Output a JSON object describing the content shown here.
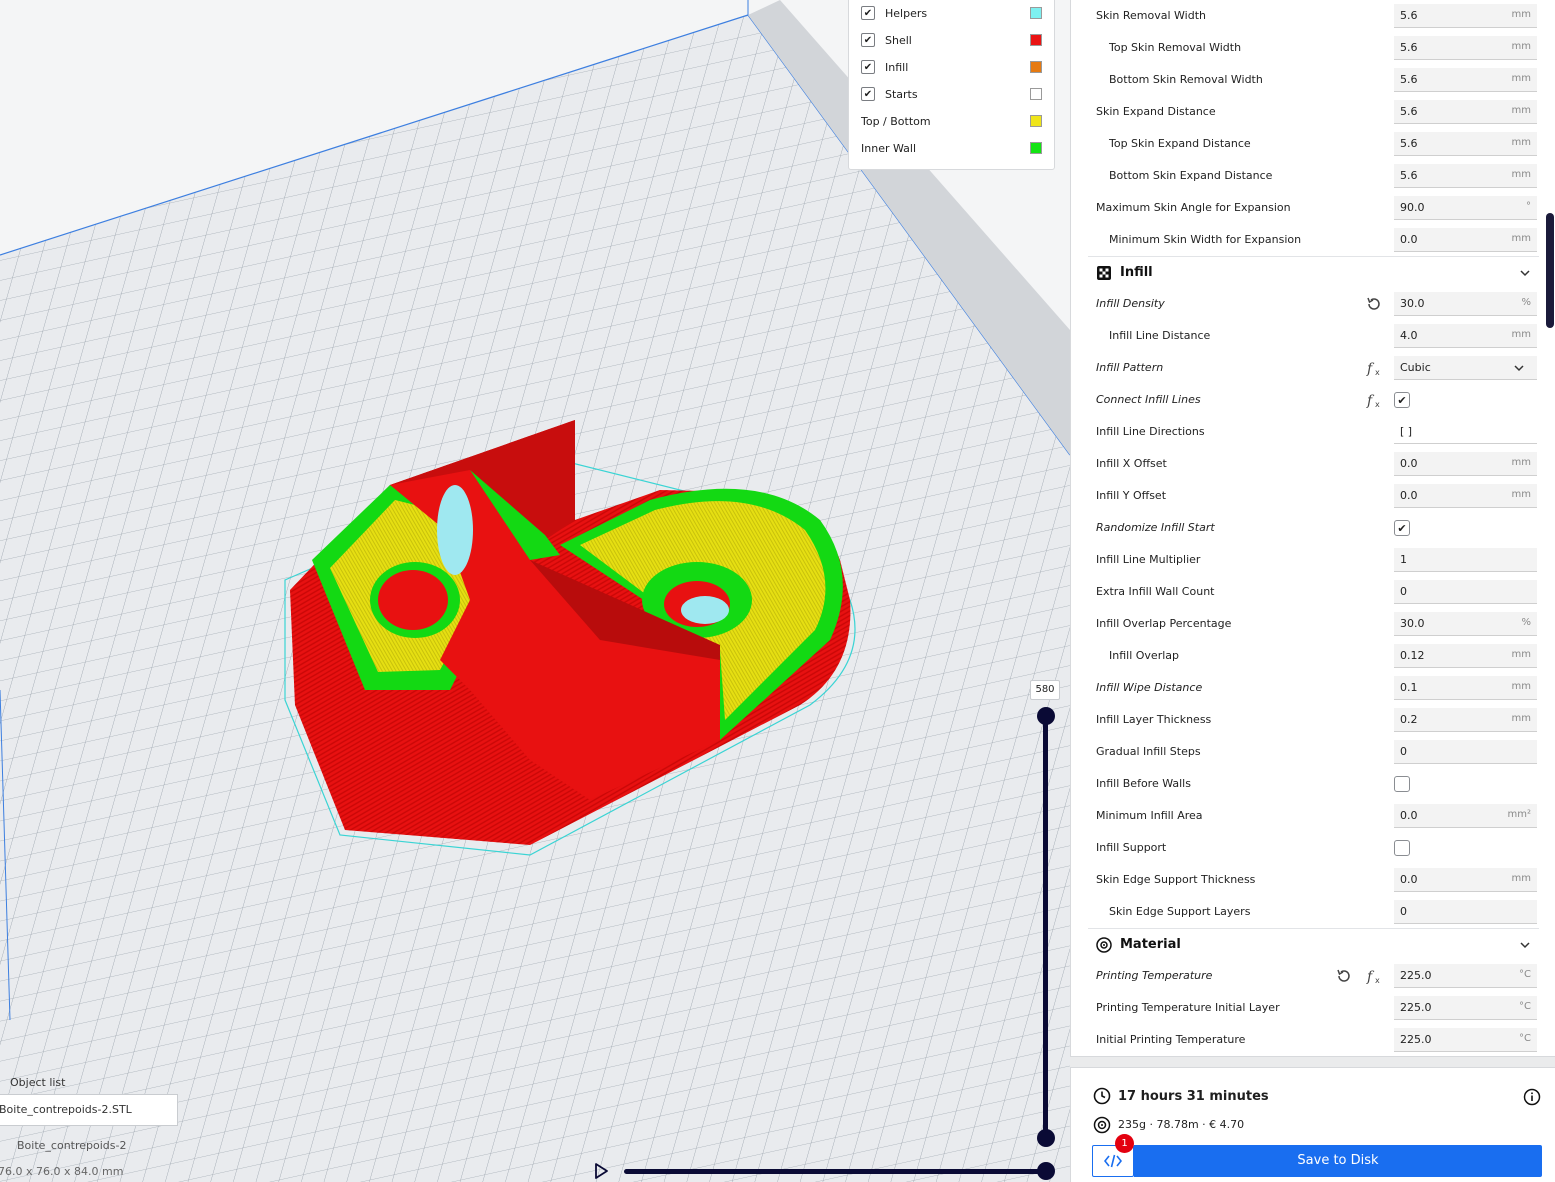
{
  "legend": [
    {
      "label": "Helpers",
      "checked": true,
      "color": "#7ef0f0"
    },
    {
      "label": "Shell",
      "checked": true,
      "color": "#ea1313"
    },
    {
      "label": "Infill",
      "checked": true,
      "color": "#e57a12"
    },
    {
      "label": "Starts",
      "checked": true,
      "color": "#ffffff"
    },
    {
      "label": "Top / Bottom",
      "checked": false,
      "color": "#efe51a"
    },
    {
      "label": "Inner Wall",
      "checked": false,
      "color": "#13e413"
    }
  ],
  "object_list": {
    "title": "Object list",
    "file": "Boite_contrepoids-2.STL",
    "object_name": "Boite_contrepoids-2",
    "dimensions": "76.0 x 76.0 x 84.0 mm"
  },
  "layer_slider": {
    "current_layer": "580"
  },
  "settings": {
    "rows_top": [
      {
        "label": "Skin Removal Width",
        "value": "5.6",
        "unit": "mm"
      },
      {
        "label": "Top Skin Removal Width",
        "value": "5.6",
        "unit": "mm",
        "indent": true
      },
      {
        "label": "Bottom Skin Removal Width",
        "value": "5.6",
        "unit": "mm",
        "indent": true
      },
      {
        "label": "Skin Expand Distance",
        "value": "5.6",
        "unit": "mm"
      },
      {
        "label": "Top Skin Expand Distance",
        "value": "5.6",
        "unit": "mm",
        "indent": true
      },
      {
        "label": "Bottom Skin Expand Distance",
        "value": "5.6",
        "unit": "mm",
        "indent": true
      },
      {
        "label": "Maximum Skin Angle for Expansion",
        "value": "90.0",
        "unit": "°"
      },
      {
        "label": "Minimum Skin Width for Expansion",
        "value": "0.0",
        "unit": "mm",
        "indent": true
      }
    ],
    "infill_category": "Infill",
    "infill_rows": [
      {
        "label": "Infill Density",
        "value": "30.0",
        "unit": "%",
        "italic": true,
        "reset": true
      },
      {
        "label": "Infill Line Distance",
        "value": "4.0",
        "unit": "mm",
        "indent": true
      },
      {
        "label": "Infill Pattern",
        "value": "Cubic",
        "combo": true,
        "italic": true,
        "fx": true
      },
      {
        "label": "Connect Infill Lines",
        "checkbox": true,
        "checked": true,
        "italic": true,
        "fx": true
      },
      {
        "label": "Infill Line Directions",
        "value": "[ ]",
        "plain": true
      },
      {
        "label": "Infill X Offset",
        "value": "0.0",
        "unit": "mm"
      },
      {
        "label": "Infill Y Offset",
        "value": "0.0",
        "unit": "mm"
      },
      {
        "label": "Randomize Infill Start",
        "checkbox": true,
        "checked": true,
        "italic": true
      },
      {
        "label": "Infill Line Multiplier",
        "value": "1",
        "unit": ""
      },
      {
        "label": "Extra Infill Wall Count",
        "value": "0",
        "unit": ""
      },
      {
        "label": "Infill Overlap Percentage",
        "value": "30.0",
        "unit": "%"
      },
      {
        "label": "Infill Overlap",
        "value": "0.12",
        "unit": "mm",
        "indent": true
      },
      {
        "label": "Infill Wipe Distance",
        "value": "0.1",
        "unit": "mm",
        "italic": true
      },
      {
        "label": "Infill Layer Thickness",
        "value": "0.2",
        "unit": "mm"
      },
      {
        "label": "Gradual Infill Steps",
        "value": "0",
        "unit": ""
      },
      {
        "label": "Infill Before Walls",
        "checkbox": true,
        "checked": false
      },
      {
        "label": "Minimum Infill Area",
        "value": "0.0",
        "unit": "mm²"
      },
      {
        "label": "Infill Support",
        "checkbox": true,
        "checked": false
      },
      {
        "label": "Skin Edge Support Thickness",
        "value": "0.0",
        "unit": "mm"
      },
      {
        "label": "Skin Edge Support Layers",
        "value": "0",
        "unit": "",
        "indent": true
      }
    ],
    "material_category": "Material",
    "material_rows": [
      {
        "label": "Printing Temperature",
        "value": "225.0",
        "unit": "°C",
        "italic": true,
        "reset": true,
        "fx": true
      },
      {
        "label": "Printing Temperature Initial Layer",
        "value": "225.0",
        "unit": "°C"
      },
      {
        "label": "Initial Printing Temperature",
        "value": "225.0",
        "unit": "°C"
      }
    ]
  },
  "summary": {
    "print_time": "17 hours 31 minutes",
    "material_usage": "235g · 78.78m · € 4.70",
    "badge_count": "1",
    "save_label": "Save to Disk"
  },
  "colors": {
    "accent": "#196ef0",
    "shell": "#ea1313",
    "inner_wall": "#13e413",
    "top_bottom": "#efe51a",
    "helpers": "#7ef0f0",
    "slider": "#0a0a35"
  }
}
